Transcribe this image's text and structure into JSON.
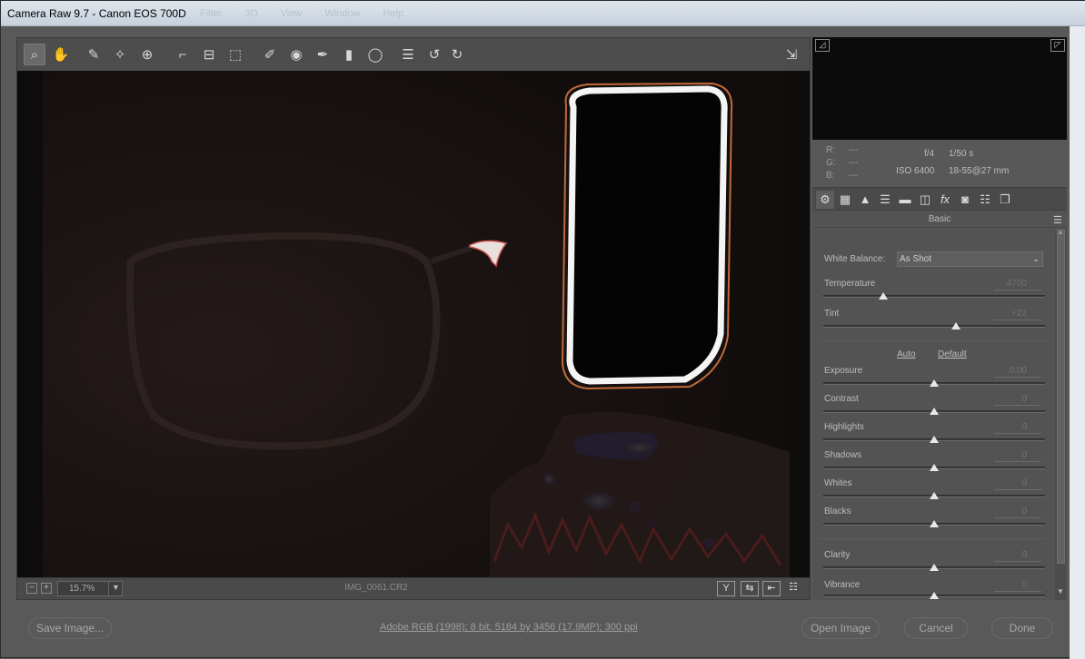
{
  "window": {
    "title": "Camera Raw 9.7  -  Canon EOS 700D",
    "menus": [
      "Filter",
      "3D",
      "View",
      "Window",
      "Help"
    ]
  },
  "toolbar": {
    "tools": [
      {
        "name": "zoom-tool",
        "glyph": "⌕",
        "active": true
      },
      {
        "name": "hand-tool",
        "glyph": "✋",
        "active": false
      },
      {
        "name": "white-balance-tool",
        "glyph": "✎",
        "active": false
      },
      {
        "name": "color-sampler-tool",
        "glyph": "✧",
        "active": false
      },
      {
        "name": "targeted-adjustment-tool",
        "glyph": "⊕",
        "active": false
      },
      {
        "name": "crop-tool",
        "glyph": "⌐",
        "active": false
      },
      {
        "name": "straighten-tool",
        "glyph": "⊟",
        "active": false
      },
      {
        "name": "transform-tool",
        "glyph": "⬚",
        "active": false
      },
      {
        "name": "spot-removal-tool",
        "glyph": "✐",
        "active": false
      },
      {
        "name": "red-eye-tool",
        "glyph": "◉",
        "active": false
      },
      {
        "name": "adjustment-brush",
        "glyph": "✒",
        "active": false
      },
      {
        "name": "graduated-filter",
        "glyph": "▮",
        "active": false
      },
      {
        "name": "radial-filter",
        "glyph": "◯",
        "active": false
      },
      {
        "name": "preferences",
        "glyph": "☰",
        "active": false
      },
      {
        "name": "rotate-left",
        "glyph": "↺",
        "active": false
      },
      {
        "name": "rotate-right",
        "glyph": "↻",
        "active": false
      }
    ],
    "fullscreen_glyph": "⇲"
  },
  "status": {
    "zoom": "15.7%",
    "filename": "IMG_0061.CR2",
    "view_buttons": [
      "Y",
      "⇆",
      "⇤",
      "☷"
    ]
  },
  "readout": {
    "r_label": "R:",
    "r_value": "---",
    "g_label": "G:",
    "g_value": "---",
    "b_label": "B:",
    "b_value": "---",
    "aperture": "f/4",
    "shutter": "1/50 s",
    "iso": "ISO 6400",
    "lens": "18-55@27 mm"
  },
  "panel": {
    "tabs": [
      "⚙",
      "▦",
      "▲",
      "☰",
      "▬",
      "◫",
      "fx",
      "◙",
      "☷",
      "❐"
    ],
    "name": "Basic",
    "white_balance_label": "White Balance:",
    "white_balance_value": "As Shot",
    "auto_link": "Auto",
    "default_link": "Default",
    "sliders": [
      {
        "label": "Temperature",
        "value": "4700",
        "pos": 0.27
      },
      {
        "label": "Tint",
        "value": "+22",
        "pos": 0.6
      },
      {
        "label": "Exposure",
        "value": "0.00",
        "pos": 0.5
      },
      {
        "label": "Contrast",
        "value": "0",
        "pos": 0.5
      },
      {
        "label": "Highlights",
        "value": "0",
        "pos": 0.5
      },
      {
        "label": "Shadows",
        "value": "0",
        "pos": 0.5
      },
      {
        "label": "Whites",
        "value": "0",
        "pos": 0.5
      },
      {
        "label": "Blacks",
        "value": "0",
        "pos": 0.5
      },
      {
        "label": "Clarity",
        "value": "0",
        "pos": 0.5
      },
      {
        "label": "Vibrance",
        "value": "0",
        "pos": 0.5
      }
    ]
  },
  "footer": {
    "save_label": "Save Image...",
    "workflow_link": "Adobe RGB (1998); 8 bit; 5184 by 3456 (17.9MP); 300 ppi",
    "open_label": "Open Image",
    "cancel_label": "Cancel",
    "done_label": "Done"
  }
}
